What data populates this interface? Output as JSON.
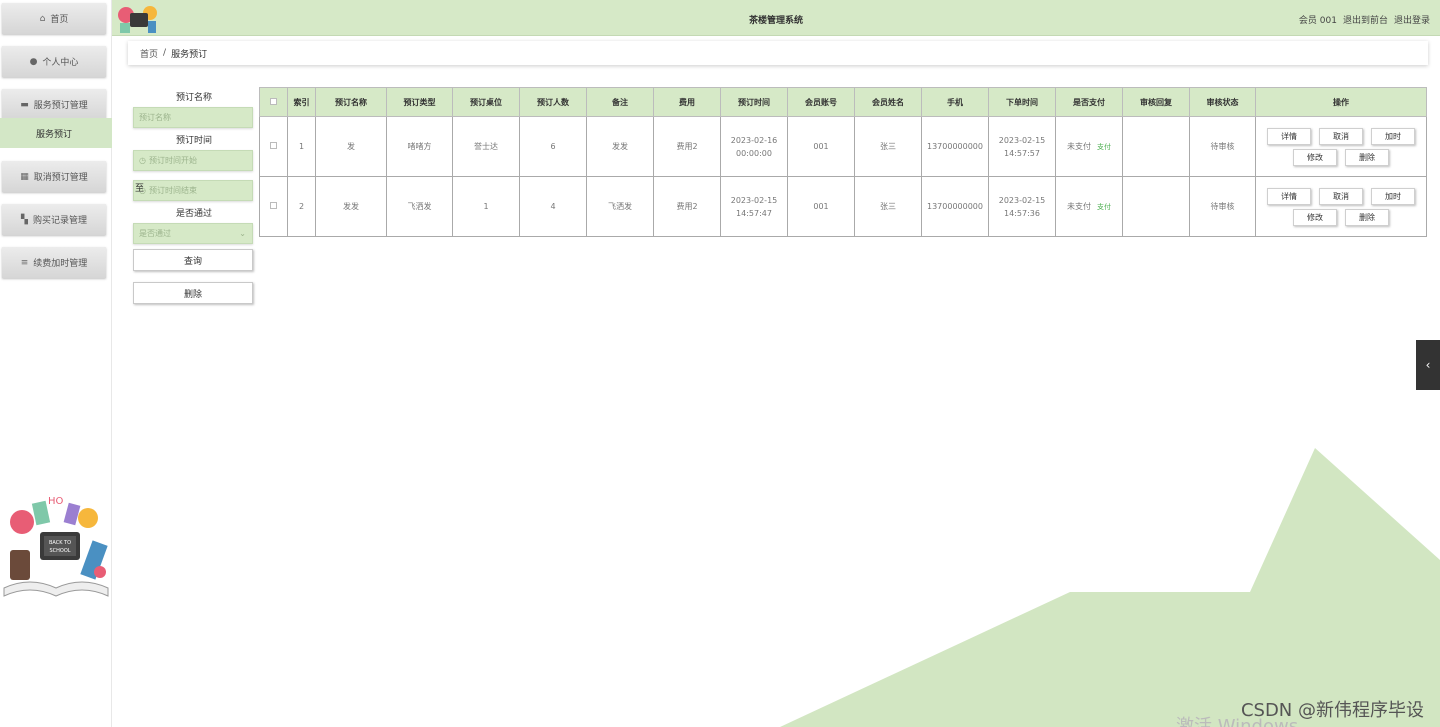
{
  "header": {
    "title": "茶楼管理系统",
    "user_label": "会员 001",
    "front_link": "退出到前台",
    "logout_link": "退出登录"
  },
  "sidebar": {
    "items": [
      {
        "label": "首页",
        "icon": "home-icon"
      },
      {
        "label": "个人中心",
        "icon": "user-icon"
      },
      {
        "label": "服务预订管理",
        "icon": "monitor-icon"
      },
      {
        "label": "取消预订管理",
        "icon": "grid-icon"
      },
      {
        "label": "购买记录管理",
        "icon": "apps-icon"
      },
      {
        "label": "续费加时管理",
        "icon": "list-icon"
      }
    ],
    "active_sub": "服务预订"
  },
  "breadcrumb": {
    "home": "首页",
    "sep": "/",
    "current": "服务预订"
  },
  "search": {
    "name_label": "预订名称",
    "name_placeholder": "预订名称",
    "time_label": "预订时间",
    "time_start_placeholder": "预订时间开始",
    "to_label": "至",
    "time_end_placeholder": "预订时间结束",
    "pass_label": "是否通过",
    "pass_placeholder": "是否通过",
    "query_button": "查询",
    "delete_button": "删除"
  },
  "table": {
    "headers": [
      "索引",
      "预订名称",
      "预订类型",
      "预订桌位",
      "预订人数",
      "备注",
      "费用",
      "预订时间",
      "会员账号",
      "会员姓名",
      "手机",
      "下单时间",
      "是否支付",
      "审核回复",
      "审核状态",
      "操作"
    ],
    "rows": [
      {
        "index": "1",
        "name": "发",
        "type": "啫啫方",
        "table": "誉士达",
        "people": "6",
        "note": "发发",
        "fee": "费用2",
        "time": "2023-02-16 00:00:00",
        "account": "001",
        "member": "张三",
        "phone": "13700000000",
        "order_time": "2023-02-15 14:57:57",
        "paid": "未支付",
        "pay_link": "支付",
        "reply": "",
        "status": "待审核"
      },
      {
        "index": "2",
        "name": "发发",
        "type": "飞洒发",
        "table": "1",
        "people": "4",
        "note": "飞洒发",
        "fee": "费用2",
        "time": "2023-02-15 14:57:47",
        "account": "001",
        "member": "张三",
        "phone": "13700000000",
        "order_time": "2023-02-15 14:57:36",
        "paid": "未支付",
        "pay_link": "支付",
        "reply": "",
        "status": "待审核"
      }
    ],
    "ops": {
      "detail": "详情",
      "cancel": "取消",
      "extend": "加时",
      "edit": "修改",
      "delete": "删除"
    }
  },
  "watermark": "CSDN @新伟程序毕设",
  "activate_text": "激活 Windows",
  "colors": {
    "accent": "#d6e9c7",
    "pay_link": "#4caf50"
  }
}
